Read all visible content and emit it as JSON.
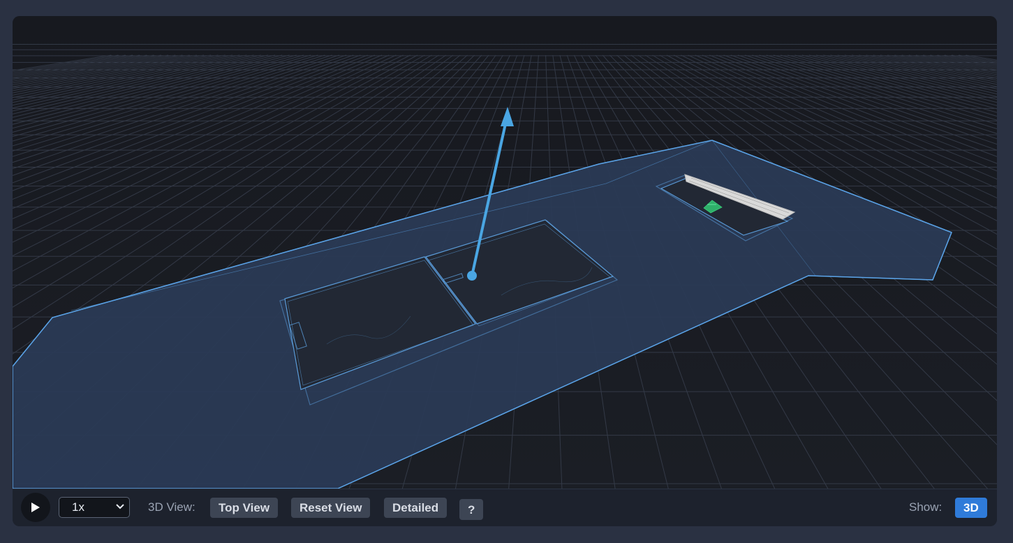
{
  "viewer": {
    "speed_value": "1x",
    "view_label": "3D View:",
    "top_view_label": "Top View",
    "reset_view_label": "Reset View",
    "detailed_label": "Detailed",
    "help_label": "?",
    "show_label": "Show:",
    "mode_3d_label": "3D"
  },
  "icons": {
    "play": "play-icon",
    "dropdown": "chevron-down-icon"
  },
  "colors": {
    "accent": "#2f7bd9",
    "outline": "#5aa2e6",
    "arrow": "#4aa6e3",
    "grid": "#3a4150",
    "floor": "#2a3a55"
  }
}
